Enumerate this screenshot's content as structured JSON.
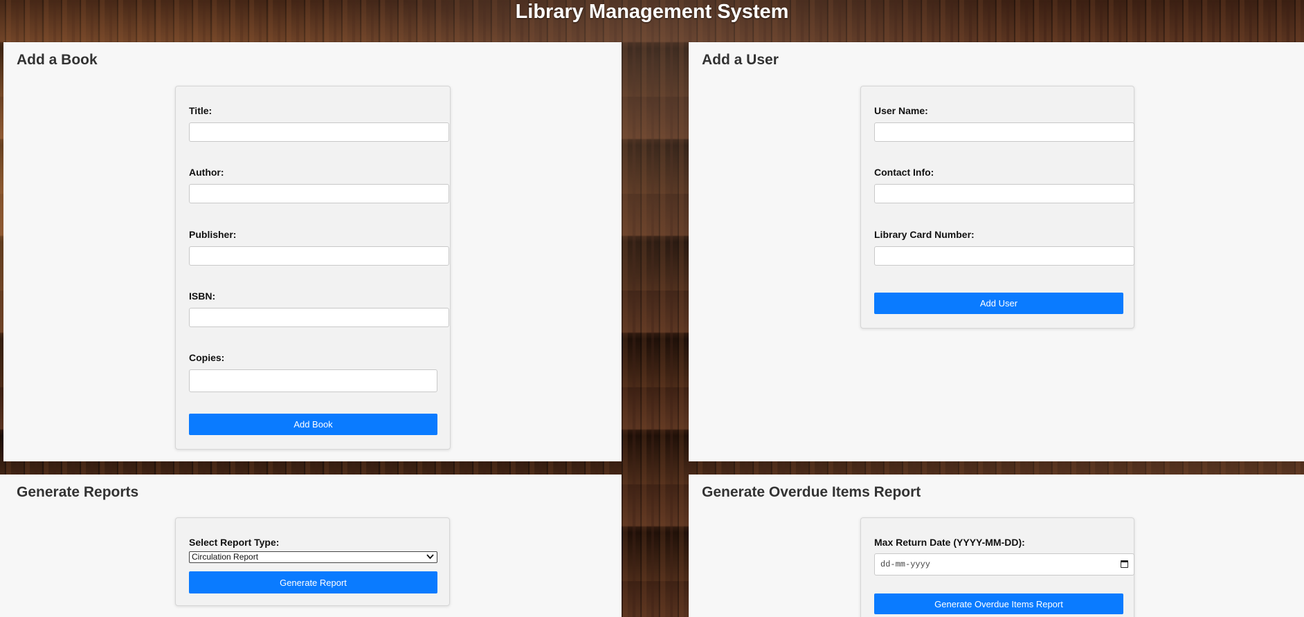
{
  "app": {
    "title": "Library Management System"
  },
  "add_book": {
    "title": "Add a Book",
    "fields": {
      "title_label": "Title:",
      "title_value": "",
      "author_label": "Author:",
      "author_value": "",
      "publisher_label": "Publisher:",
      "publisher_value": "",
      "isbn_label": "ISBN:",
      "isbn_value": "",
      "copies_label": "Copies:",
      "copies_value": ""
    },
    "submit_label": "Add Book"
  },
  "add_user": {
    "title": "Add a User",
    "fields": {
      "user_name_label": "User Name:",
      "user_name_value": "",
      "contact_label": "Contact Info:",
      "contact_value": "",
      "card_label": "Library Card Number:",
      "card_value": ""
    },
    "submit_label": "Add User"
  },
  "reports": {
    "title": "Generate Reports",
    "select_label": "Select Report Type:",
    "selected_option": "Circulation Report",
    "submit_label": "Generate Report"
  },
  "overdue": {
    "title": "Generate Overdue Items Report",
    "date_label": "Max Return Date (YYYY-MM-DD):",
    "date_placeholder": "dd-mm-yyyy",
    "submit_label": "Generate Overdue Items Report"
  },
  "icons": {
    "select_chevron": "chevron-down-icon",
    "date_picker": "calendar-icon"
  },
  "colors": {
    "primary_button": "#0a7bff",
    "panel_background": "#f7f7f7",
    "card_background": "#f2f2f2",
    "title_text": "#ffffff"
  }
}
